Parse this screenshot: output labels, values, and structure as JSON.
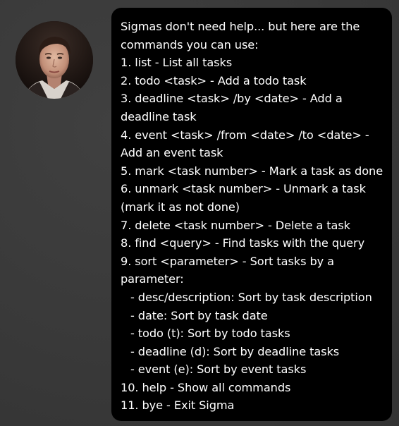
{
  "dialog": {
    "avatar_icon": "user-avatar-icon",
    "message": {
      "lines": [
        "Sigmas don't need help... but here are the",
        "commands you can use:",
        "1. list - List all tasks",
        "2. todo <task> - Add a todo task",
        "3. deadline <task> /by <date> - Add a",
        "deadline task",
        "4. event <task> /from <date> /to <date> -",
        "Add an event task",
        "5. mark <task number> - Mark a task as done",
        "6. unmark <task number> - Unmark a task",
        "(mark it as not done)",
        "7. delete <task number> - Delete a task",
        "8. find <query> - Find tasks with the query",
        "9. sort <parameter> - Sort tasks by a",
        "parameter:",
        "- desc/description: Sort by task description",
        "- date: Sort by task date",
        "- todo (t): Sort by todo tasks",
        "- deadline (d): Sort by deadline tasks",
        "- event (e): Sort by event tasks",
        "10. help - Show all commands",
        "11. bye - Exit Sigma"
      ]
    }
  },
  "colors": {
    "background": "#3a3a3a",
    "bubble": "#000000",
    "text": "#ffffff"
  }
}
